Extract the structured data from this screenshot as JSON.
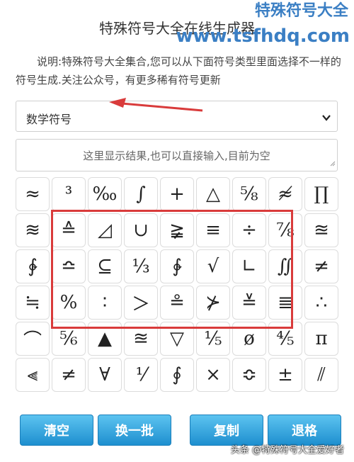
{
  "watermark": {
    "top_text": "特殊符号大全",
    "url": "www.tsfhdq.com",
    "footer": "头条 @特殊符号大全爱好者"
  },
  "header": {
    "title": "特殊符号大全在线生成器"
  },
  "description": "说明:特殊符号大全集合,您可以从下面符号类型里面选择不一样的符号生成.关注公众号，有更多稀有符号更新",
  "category_select": {
    "selected": "数学符号"
  },
  "result_box": {
    "placeholder": "这里显示结果,也可以直接输入,目前为空"
  },
  "symbols": [
    "≈",
    "³",
    "‰",
    "∫",
    "+",
    "△",
    "⅝",
    "≉",
    "∏",
    "≋",
    "≙",
    "◿",
    "∪",
    "≩",
    "≡",
    "÷",
    "⅞",
    "≊",
    "∲",
    "≏",
    "⊆",
    "⅓",
    "∲",
    "√",
    "∟",
    "∬",
    "≠",
    "≒",
    "%",
    "∶",
    "＞",
    "≗",
    "⊁",
    "≚",
    "≣",
    "∴",
    "⌒",
    "⅚",
    "▲",
    "≊",
    "▽",
    "⅕",
    "ø",
    "⅘",
    "π",
    "⫷",
    "≠",
    "∀",
    "⅟",
    "∮",
    "×",
    "≎",
    "±",
    "⫽"
  ],
  "buttons": {
    "clear": "清空",
    "refresh": "换一批",
    "copy": "复制",
    "backspace": "退格"
  },
  "colors": {
    "button": "#2a9ad8",
    "highlight": "#d93b3b",
    "watermark": "#3b7fc4"
  }
}
